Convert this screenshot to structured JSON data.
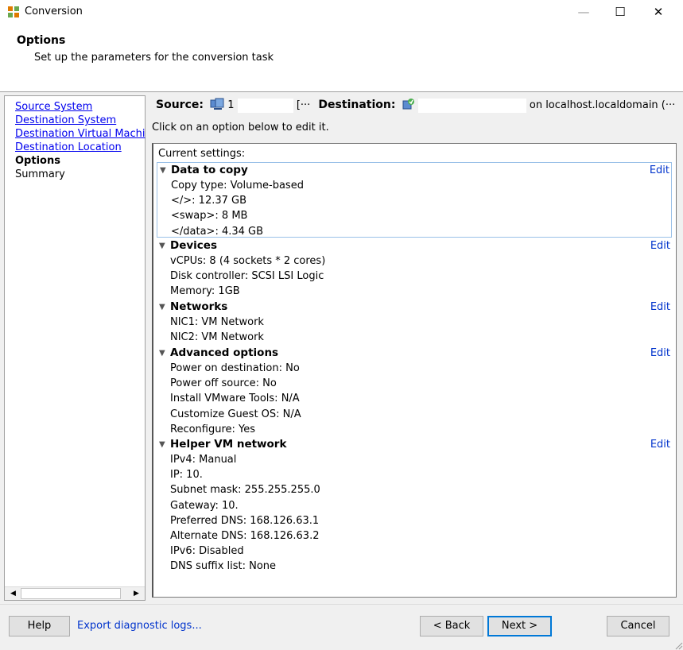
{
  "window": {
    "title": "Conversion",
    "minimize_glyph": "—",
    "maximize_glyph": "☐",
    "close_glyph": "✕"
  },
  "header": {
    "title": "Options",
    "subtitle": "Set up the parameters for the conversion task"
  },
  "nav": {
    "items": [
      {
        "label": "Source System",
        "state": "link"
      },
      {
        "label": "Destination System",
        "state": "link"
      },
      {
        "label": "Destination Virtual Machi",
        "state": "link"
      },
      {
        "label": "Destination Location",
        "state": "link"
      },
      {
        "label": "Options",
        "state": "current"
      },
      {
        "label": "Summary",
        "state": "plain"
      }
    ]
  },
  "source_destination": {
    "source_label": "Source:",
    "source_value": "1",
    "source_suffix": "[···",
    "destination_label": "Destination:",
    "destination_suffix": "on localhost.localdomain (···"
  },
  "hint": "Click on an option below to edit it.",
  "settings": {
    "current_label": "Current settings:",
    "edit_label": "Edit",
    "sections": [
      {
        "title": "Data to copy",
        "lines": [
          "Copy type: Volume-based",
          "</>: 12.37 GB",
          "<swap>: 8 MB",
          "</data>: 4.34 GB"
        ]
      },
      {
        "title": "Devices",
        "lines": [
          "vCPUs: 8 (4 sockets * 2 cores)",
          "Disk controller: SCSI LSI Logic",
          "Memory: 1GB"
        ]
      },
      {
        "title": "Networks",
        "lines": [
          "NIC1: VM Network",
          "NIC2: VM Network"
        ]
      },
      {
        "title": "Advanced options",
        "lines": [
          "Power on destination: No",
          "Power off source: No",
          "Install VMware Tools: N/A",
          "Customize Guest OS: N/A",
          "Reconfigure: Yes"
        ]
      },
      {
        "title": "Helper VM network",
        "lines": [
          "IPv4: Manual",
          "IP: 10.",
          "Subnet mask: 255.255.255.0",
          "Gateway: 10.",
          "Preferred DNS: 168.126.63.1",
          "Alternate DNS: 168.126.63.2",
          "IPv6: Disabled",
          "DNS suffix list: None"
        ]
      }
    ]
  },
  "footer": {
    "help": "Help",
    "export": "Export diagnostic logs...",
    "back": "< Back",
    "next": "Next >",
    "cancel": "Cancel"
  },
  "colors": {
    "link": "#0000ee",
    "edit": "#0033cc",
    "selection_border": "#9bc1e8"
  }
}
